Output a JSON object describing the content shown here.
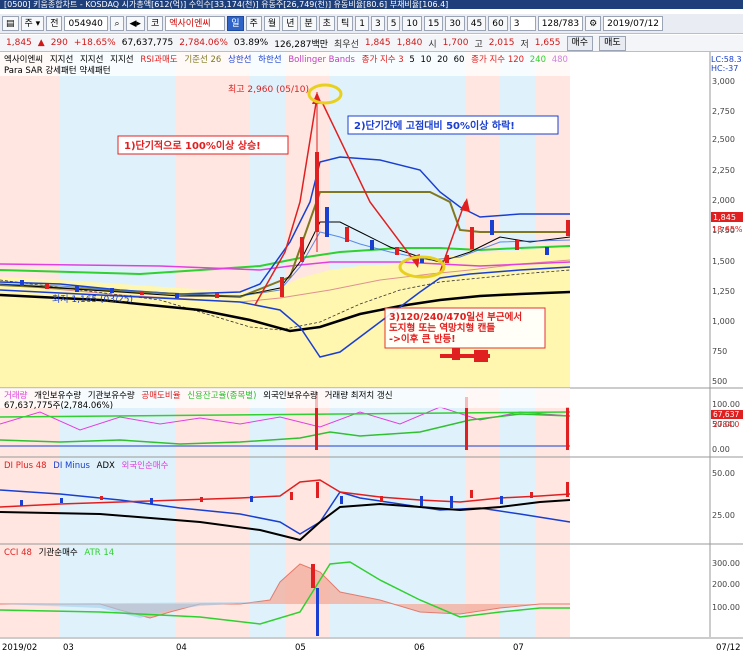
{
  "window": {
    "title": "[0500] 키움종합차트 - KOSDAQ 시가총액[612(억)] 수익수[33,174(천)] 유동주[26,749(천)] 유동비율[80.6] 부채비율[106.4]"
  },
  "toolbar": {
    "stock_code": "054940",
    "stock_name": "엑사이엔씨",
    "period_buttons": [
      "일",
      "주",
      "월",
      "년",
      "분",
      "초",
      "틱"
    ],
    "selected_period": "일",
    "interval_buttons": [
      "1",
      "3",
      "5",
      "10",
      "15",
      "30",
      "45",
      "60"
    ],
    "interval_value": "3",
    "count": "128/783",
    "date": "2019/07/12"
  },
  "quote": {
    "price": "1,845",
    "change": "290",
    "change_pct": "+18.65%",
    "volume": "67,637,775",
    "volume_pct": "2,784.06%",
    "turnover_pct": "03.89%",
    "amount": "126,287백만",
    "best_bid_label": "최우선",
    "best_ask": "1,845",
    "best_bid": "1,840",
    "open_label": "시",
    "open": "1,700",
    "high_label": "고",
    "high": "2,015",
    "low_label": "저",
    "low": "1,655",
    "buy_button": "매수",
    "sell_button": "매도"
  },
  "price_panel": {
    "legend_line1": [
      "엑사이엔씨",
      "지지선",
      "지지선",
      "지지선",
      "RSI과매도",
      "기준선 26",
      "상한선",
      "하한선",
      "Bollinger Bands",
      "종가 지수 3",
      "5",
      "10",
      "20",
      "60",
      "종가 지수 120",
      "240",
      "480"
    ],
    "legend_line2": "Para SAR 강세패턴  약세패턴",
    "right_top_labels": [
      "LC:58.3",
      "HC:-37"
    ],
    "y_ticks": [
      "3,000",
      "2,750",
      "2,500",
      "2,250",
      "2,000",
      "1,750",
      "1,500",
      "1,250",
      "1,000",
      "750",
      "500"
    ],
    "price_tag": "1,845",
    "price_pct_tag": "18.65%",
    "high_label": "최고 2,960 (05/10)",
    "low_label": "최저 1,165 (03/25)",
    "annotation1": "1)단기적으로 100%이상 상승!",
    "annotation2": "2)단기간에 고점대비 50%이상 하락!",
    "annotation3": [
      "3)120/240/470일선 부근에서",
      "도지형 또는 역망치형 캔들",
      "->이후 큰 반등!"
    ]
  },
  "volume_panel": {
    "legend": [
      "거래량",
      "개인보유수량",
      "기관보유수량",
      "공매도비율",
      "신용잔고율(종목별)",
      "외국인보유수량",
      "거래량 최저치 갱신"
    ],
    "value_label": "67,637,775주(2,784.06%)",
    "y_ticks": [
      "100.00",
      "50.00",
      "0.00"
    ],
    "tags": [
      "67,637",
      "2784.0"
    ]
  },
  "dmi_panel": {
    "legend": [
      "DI Plus 48",
      "DI Minus",
      "ADX",
      "외국인순매수"
    ],
    "y_ticks": [
      "50.00",
      "25.00"
    ]
  },
  "cci_panel": {
    "legend": [
      "CCI 48",
      "기관순매수",
      "ATR 14"
    ],
    "y_ticks": [
      "300.00",
      "200.00",
      "100.00"
    ]
  },
  "x_axis": {
    "labels": [
      "2019/02",
      "03",
      "04",
      "05",
      "06",
      "07"
    ],
    "right_label": "07/12"
  },
  "colors": {
    "up": "#e02020",
    "down": "#1a3fd0",
    "bg_highlight": "#ffe6e0",
    "bg_blue": "#dff2fb",
    "bg_yellow": "#fff8c4"
  }
}
